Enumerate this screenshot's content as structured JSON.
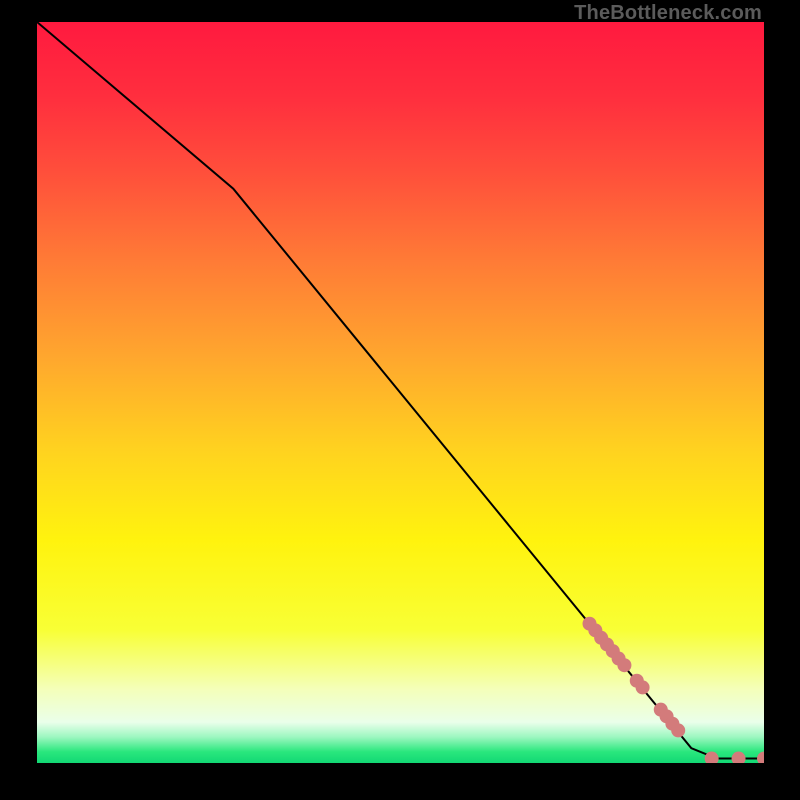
{
  "attribution": "TheBottleneck.com",
  "colors": {
    "frame": "#000000",
    "line": "#000000",
    "marker": "#d37b7b",
    "gradient_stops": [
      {
        "offset": 0.0,
        "color": "#ff1a3f"
      },
      {
        "offset": 0.1,
        "color": "#ff2e3e"
      },
      {
        "offset": 0.2,
        "color": "#ff4e3b"
      },
      {
        "offset": 0.32,
        "color": "#ff7a36"
      },
      {
        "offset": 0.45,
        "color": "#ffa62e"
      },
      {
        "offset": 0.58,
        "color": "#ffd31f"
      },
      {
        "offset": 0.7,
        "color": "#fff30e"
      },
      {
        "offset": 0.82,
        "color": "#f8ff35"
      },
      {
        "offset": 0.9,
        "color": "#f4ffb9"
      },
      {
        "offset": 0.945,
        "color": "#eaffea"
      },
      {
        "offset": 0.965,
        "color": "#9cf7c0"
      },
      {
        "offset": 0.985,
        "color": "#29e77d"
      },
      {
        "offset": 1.0,
        "color": "#12d874"
      }
    ]
  },
  "chart_data": {
    "type": "line",
    "title": "",
    "xlabel": "",
    "ylabel": "",
    "xlim": [
      0,
      100
    ],
    "ylim": [
      0,
      100
    ],
    "line_points": [
      {
        "x": 0.0,
        "y": 100.0
      },
      {
        "x": 27.0,
        "y": 77.5
      },
      {
        "x": 90.0,
        "y": 2.0
      },
      {
        "x": 93.5,
        "y": 0.6
      },
      {
        "x": 100.0,
        "y": 0.6
      }
    ],
    "marker_points": [
      {
        "x": 76.0,
        "y": 18.8
      },
      {
        "x": 76.8,
        "y": 17.9
      },
      {
        "x": 77.6,
        "y": 16.9
      },
      {
        "x": 78.4,
        "y": 16.0
      },
      {
        "x": 79.2,
        "y": 15.1
      },
      {
        "x": 80.0,
        "y": 14.1
      },
      {
        "x": 80.8,
        "y": 13.2
      },
      {
        "x": 82.5,
        "y": 11.1
      },
      {
        "x": 83.3,
        "y": 10.2
      },
      {
        "x": 85.8,
        "y": 7.2
      },
      {
        "x": 86.6,
        "y": 6.3
      },
      {
        "x": 87.4,
        "y": 5.3
      },
      {
        "x": 88.2,
        "y": 4.4
      },
      {
        "x": 92.8,
        "y": 0.6
      },
      {
        "x": 96.5,
        "y": 0.6
      },
      {
        "x": 100.0,
        "y": 0.6
      }
    ]
  }
}
